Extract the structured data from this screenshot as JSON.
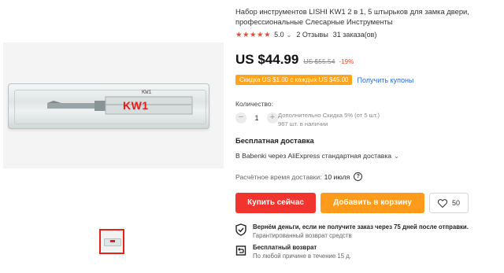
{
  "product": {
    "title": "Набор инструментов LISHI KW1 2 в 1, 5 штырьков для замка двери, профессиональные Слесарные Инструменты",
    "image_label": "KW1",
    "image_stamp": "KW1"
  },
  "rating": {
    "stars": "★★★★★",
    "value": "5.0",
    "chevron": "⌄",
    "reviews": "2 Отзывы",
    "orders": "31 заказа(ов)"
  },
  "price": {
    "current": "US $44.99",
    "old": "US $55.54",
    "discount": "-19%"
  },
  "coupon": {
    "badge": "Скидка US $1.00 с каждых US $45.00",
    "link": "Получить купоны"
  },
  "quantity": {
    "label": "Количество:",
    "minus": "−",
    "value": "1",
    "plus": "+",
    "extra_discount": "Дополнительно Скидка 5% (от 5 шт.)",
    "stock": "967 шт. в наличии"
  },
  "shipping": {
    "title": "Бесплатная доставка",
    "description": "В Babenki через AliExpress стандартная доставка",
    "chevron": "⌄",
    "estimate_label": "Расчётное время доставки:",
    "estimate_date": "10 июля",
    "help_icon": "?"
  },
  "actions": {
    "buy_now": "Купить сейчас",
    "add_to_cart": "Добавить в корзину",
    "wishlist_count": "50"
  },
  "guarantees": [
    {
      "title": "Вернём деньги, если не получите заказ через 75 дней после отправки.",
      "subtitle": "Гарантированный возврат средств",
      "icon": "shield-check-icon"
    },
    {
      "title": "Бесплатный возврат",
      "subtitle": "По любой причине в течение 15 д.",
      "icon": "return-box-icon"
    }
  ],
  "colors": {
    "accent_red": "#f1352e",
    "accent_orange": "#ff9b1c",
    "star_color": "#ef4a2f",
    "link_blue": "#2b6bd6"
  }
}
